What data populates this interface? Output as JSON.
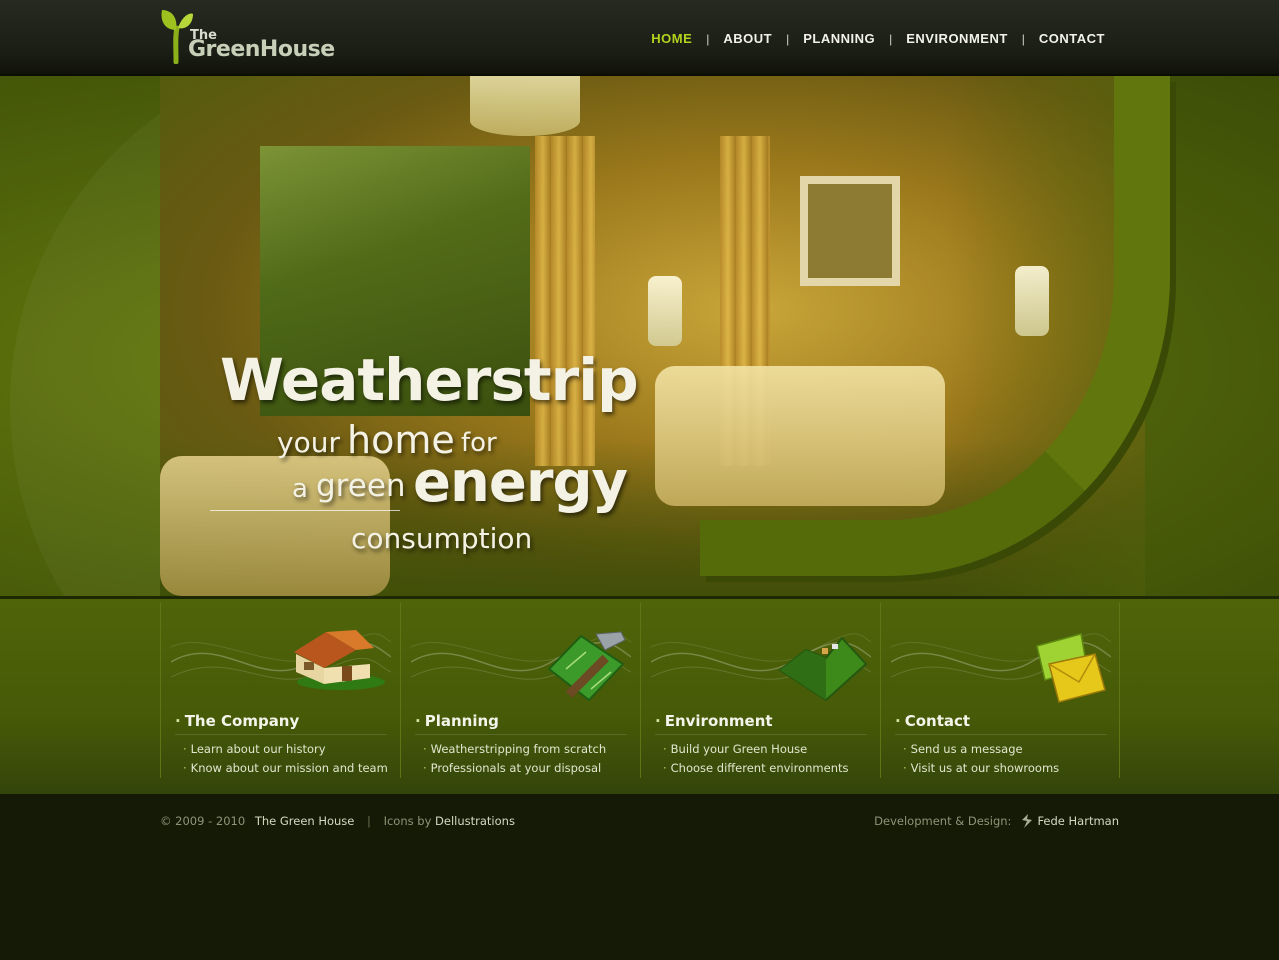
{
  "logo": {
    "the": "The",
    "name": "GreenHouse"
  },
  "nav": {
    "items": [
      {
        "label": "HOME",
        "active": true
      },
      {
        "label": "ABOUT",
        "active": false
      },
      {
        "label": "PLANNING",
        "active": false
      },
      {
        "label": "ENVIRONMENT",
        "active": false
      },
      {
        "label": "CONTACT",
        "active": false
      }
    ],
    "separator": "|"
  },
  "hero": {
    "line1": "Weatherstrip",
    "line2_a": "your",
    "line2_b": "home",
    "line2_c": "for",
    "line3_a": "a",
    "line3_b": "green",
    "line3_c": "energy",
    "line4": "consumption"
  },
  "features": [
    {
      "title": "The Company",
      "icon": "house-icon",
      "links": [
        "Learn about our history",
        "Know about our mission and team"
      ]
    },
    {
      "title": "Planning",
      "icon": "blueprint-hammer-icon",
      "links": [
        "Weatherstripping from scratch",
        "Professionals at your disposal"
      ]
    },
    {
      "title": "Environment",
      "icon": "landscape-icon",
      "links": [
        "Build your Green House",
        "Choose different environments"
      ]
    },
    {
      "title": "Contact",
      "icon": "envelope-icon",
      "links": [
        "Send us a message",
        "Visit us at our showrooms"
      ]
    }
  ],
  "footer": {
    "copyright": "© 2009 - 2010",
    "site_name": "The Green House",
    "pipe": "|",
    "icons_by": "Icons by",
    "icons_author": "Dellustrations",
    "dev_label": "Development & Design:",
    "dev_name": "Fede Hartman"
  },
  "colors": {
    "accent": "#b4d21d",
    "header_bg": "#1b1e15",
    "band_bg": "#4f6409",
    "footer_bg": "#141a05"
  }
}
